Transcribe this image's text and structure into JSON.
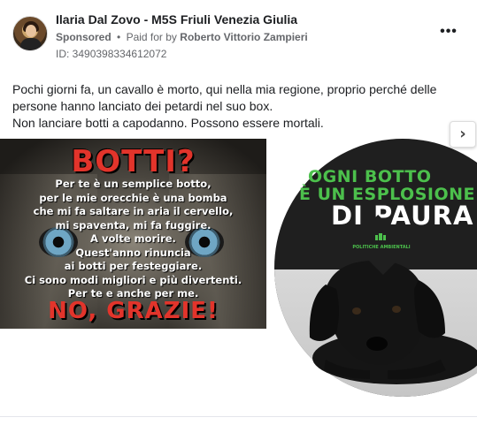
{
  "page": {
    "name": "Ilaria Dal Zovo - M5S Friuli Venezia Giulia",
    "sponsored_label": "Sponsored",
    "separator": "•",
    "paid_for_label": "Paid for by",
    "payer": "Roberto Vittorio Zampieri",
    "ad_id": "ID: 3490398334612072",
    "more_label": "•••"
  },
  "post": {
    "line1": "Pochi giorni fa, un cavallo è morto, qui nella mia regione, proprio perché delle persone hanno lanciato dei petardi nel suo box.",
    "line2": "Non lanciare botti a capodanno. Possono essere mortali."
  },
  "carousel": {
    "slide1": {
      "title": "BOTTI?",
      "poem": [
        "Per te è un semplice botto,",
        "per le mie orecchie è una bomba",
        "che mi fa saltare in aria il cervello,",
        "mi spaventa, mi fa fuggire.",
        "A volte morire.",
        "Quest'anno rinuncia",
        "ai botti per festeggiare.",
        "Ci sono modi migliori e più divertenti.",
        "Per te e anche per me."
      ],
      "footer": "NO, GRAZIE!"
    },
    "slide2": {
      "headline_line1": "OGNI BOTTO",
      "headline_line2": "È UN ESPLOSIONE",
      "headline_line3": "DI PAURA!",
      "badge_text": "POLITICHE AMBIENTALI"
    },
    "next_label": "›"
  },
  "colors": {
    "accent_red": "#e2342b",
    "accent_green": "#4cc04c",
    "meta_gray": "#65676b"
  }
}
